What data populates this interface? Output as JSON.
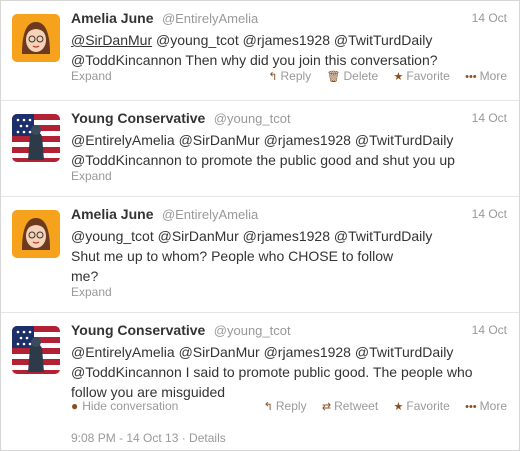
{
  "tweets": [
    {
      "fullname": "Amelia June",
      "username": "@EntirelyAmelia",
      "time": "14 Oct",
      "mentions": [
        "@SirDanMur",
        "@young_tcot",
        "@rjames1928",
        "@TwitTurdDaily",
        "@ToddKincannon"
      ],
      "body": "Then why did you join this conversation?",
      "expand": "Expand",
      "actions": {
        "reply": "Reply",
        "delete": "Delete",
        "favorite": "Favorite",
        "more": "More"
      }
    },
    {
      "fullname": "Young Conservative",
      "username": "@young_tcot",
      "time": "14 Oct",
      "mentions": [
        "@EntirelyAmelia",
        "@SirDanMur",
        "@rjames1928",
        "@TwitTurdDaily",
        "@ToddKincannon"
      ],
      "body": "to promote the public good  and shut you up",
      "expand": "Expand"
    },
    {
      "fullname": "Amelia June",
      "username": "@EntirelyAmelia",
      "time": "14 Oct",
      "mentions": [
        "@young_tcot",
        "@SirDanMur",
        "@rjames1928",
        "@TwitTurdDaily"
      ],
      "body_line1": "Shut me up to whom? People who CHOSE to follow",
      "body_line2": "me?",
      "expand": "Expand"
    },
    {
      "fullname": "Young Conservative",
      "username": "@young_tcot",
      "time": "14 Oct",
      "mentions": [
        "@EntirelyAmelia",
        "@SirDanMur",
        "@rjames1928",
        "@TwitTurdDaily",
        "@ToddKincannon"
      ],
      "body_line1": "I said to promote public good. The people who",
      "body_line2": "follow you are misguided",
      "hide_conversation": "Hide conversation",
      "actions": {
        "reply": "Reply",
        "retweet": "Retweet",
        "favorite": "Favorite",
        "more": "More"
      },
      "footer": "9:08 PM - 14 Oct 13 · Details"
    }
  ],
  "icons": {
    "reply": "reply-arrow-icon",
    "delete": "trash-icon",
    "favorite": "star-icon",
    "more": "more-dots-icon",
    "retweet": "retweet-icon",
    "conversation": "speech-bubble-icon"
  },
  "colors": {
    "action_accent": "#8a4f21",
    "muted": "#999999",
    "text": "#333333"
  }
}
